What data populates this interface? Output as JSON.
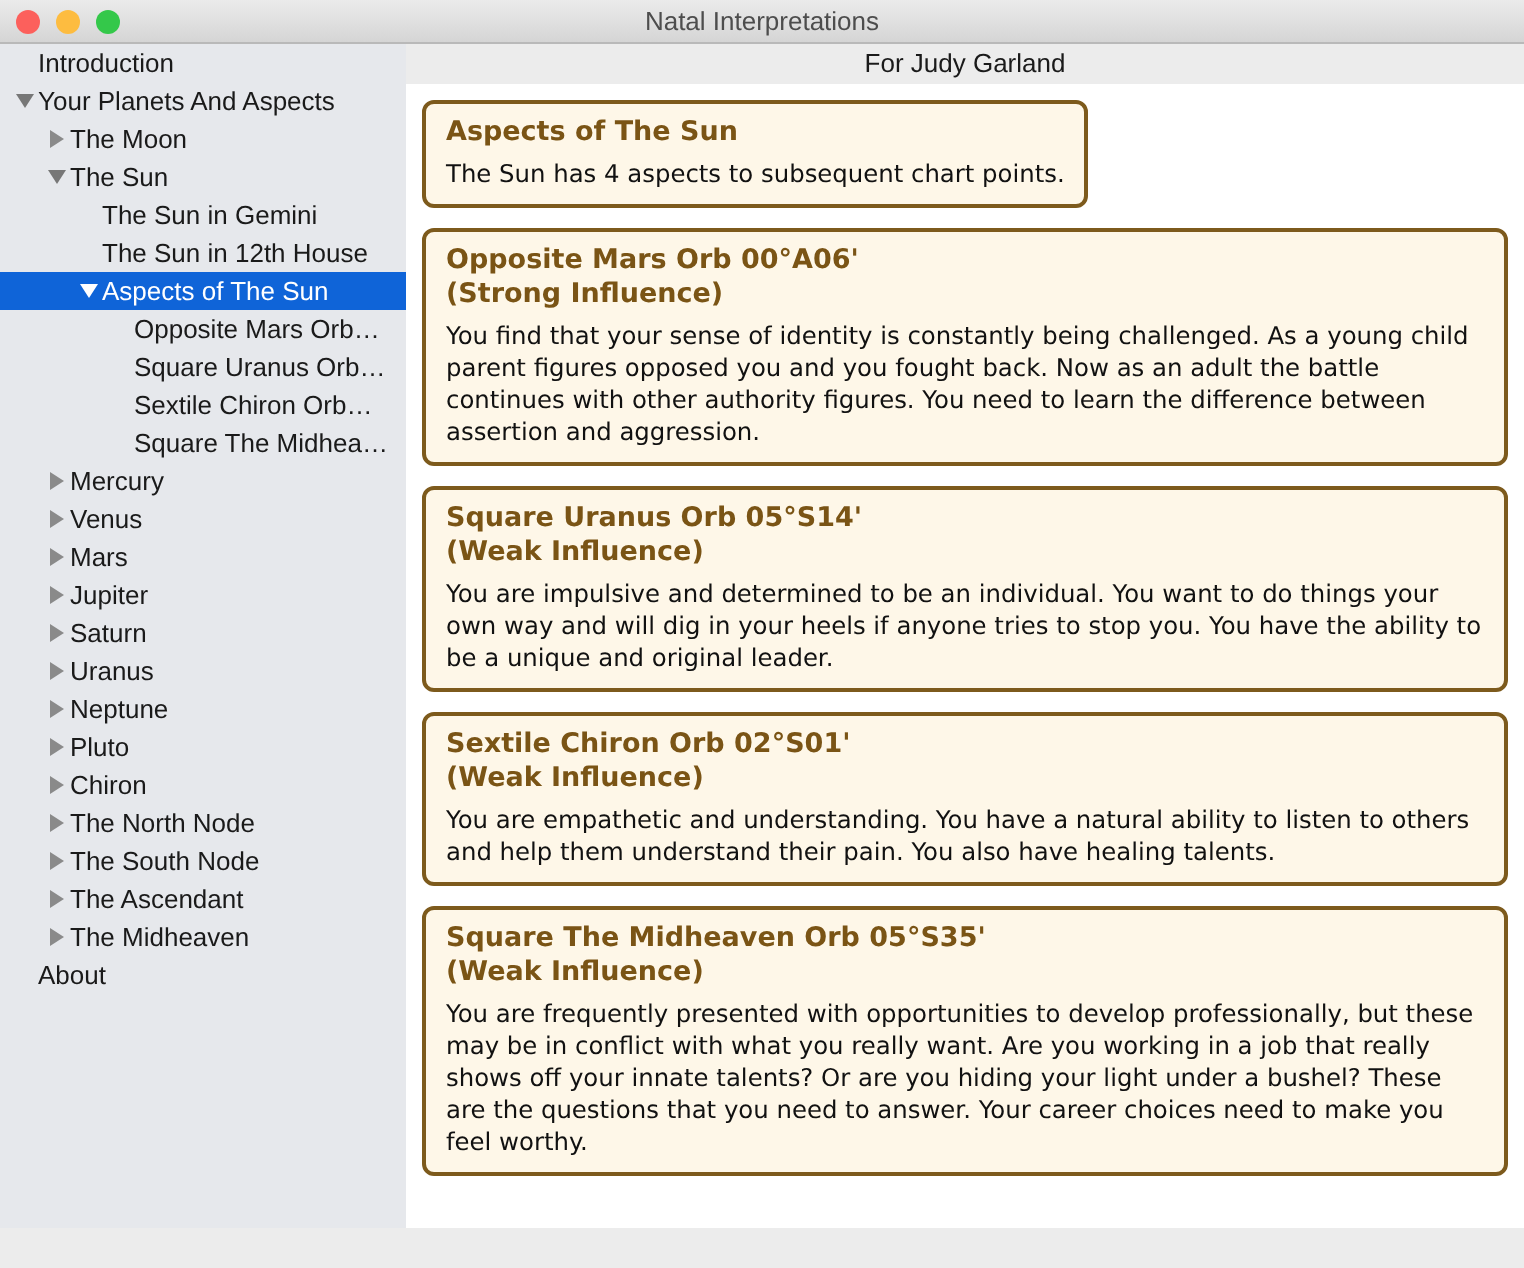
{
  "window": {
    "title": "Natal Interpretations"
  },
  "sidebar": {
    "items": [
      {
        "label": "Introduction",
        "selected": false
      },
      {
        "label": "Your Planets And Aspects",
        "selected": false,
        "expanded": true,
        "children": [
          {
            "label": "The Moon",
            "selected": false,
            "expanded": false
          },
          {
            "label": "The Sun",
            "selected": false,
            "expanded": true,
            "children": [
              {
                "label": "The Sun in Gemini",
                "selected": false
              },
              {
                "label": "The Sun in 12th House",
                "selected": false
              },
              {
                "label": "Aspects of The Sun",
                "selected": true,
                "expanded": true,
                "children": [
                  {
                    "label": "Opposite Mars Orb…",
                    "selected": false
                  },
                  {
                    "label": "Square Uranus Orb…",
                    "selected": false
                  },
                  {
                    "label": "Sextile Chiron Orb…",
                    "selected": false
                  },
                  {
                    "label": "Square The Midhea…",
                    "selected": false
                  }
                ]
              }
            ]
          },
          {
            "label": "Mercury",
            "selected": false,
            "expanded": false
          },
          {
            "label": "Venus",
            "selected": false,
            "expanded": false
          },
          {
            "label": "Mars",
            "selected": false,
            "expanded": false
          },
          {
            "label": "Jupiter",
            "selected": false,
            "expanded": false
          },
          {
            "label": "Saturn",
            "selected": false,
            "expanded": false
          },
          {
            "label": "Uranus",
            "selected": false,
            "expanded": false
          },
          {
            "label": "Neptune",
            "selected": false,
            "expanded": false
          },
          {
            "label": "Pluto",
            "selected": false,
            "expanded": false
          },
          {
            "label": "Chiron",
            "selected": false,
            "expanded": false
          },
          {
            "label": "The North Node",
            "selected": false,
            "expanded": false
          },
          {
            "label": "The South Node",
            "selected": false,
            "expanded": false
          },
          {
            "label": "The Ascendant",
            "selected": false,
            "expanded": false
          },
          {
            "label": "The Midheaven",
            "selected": false,
            "expanded": false
          }
        ]
      },
      {
        "label": "About",
        "selected": false
      }
    ]
  },
  "content": {
    "header": "For Judy Garland",
    "cards": [
      {
        "kind": "summary",
        "title": "Aspects of The Sun",
        "text": "The Sun has 4 aspects to subsequent chart points."
      },
      {
        "kind": "aspect",
        "title": "Opposite Mars Orb 00°A06'",
        "influence": "(Strong Influence)",
        "text": "You find that your sense of identity is constantly being challenged. As a young child parent figures opposed you and you fought back. Now as an adult the battle continues with other authority figures. You need to learn the difference between assertion and aggression."
      },
      {
        "kind": "aspect",
        "title": "Square Uranus Orb 05°S14'",
        "influence": "(Weak Influence)",
        "text": "You are impulsive and determined to be an individual. You want to do things your own way and will dig in your heels if anyone tries to stop you. You have the ability to be a unique and original leader."
      },
      {
        "kind": "aspect",
        "title": "Sextile Chiron Orb 02°S01'",
        "influence": "(Weak Influence)",
        "text": "You are empathetic and understanding. You have a natural ability to listen to others and help them understand their pain. You also have healing talents."
      },
      {
        "kind": "aspect",
        "title": "Square The Midheaven Orb 05°S35'",
        "influence": "(Weak Influence)",
        "text": "You are frequently presented with opportunities to develop professionally, but these may be in conflict with what you really want. Are you working in a job that really shows off your innate talents? Or are you hiding your light under a bushel? These are the questions that you need to answer. Your career choices need to make you feel worthy."
      }
    ]
  }
}
